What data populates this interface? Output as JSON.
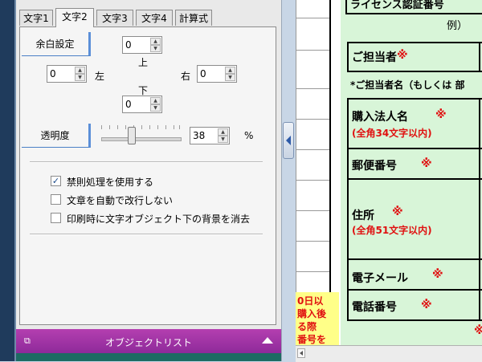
{
  "tabs": [
    {
      "label": "文字1",
      "active": false
    },
    {
      "label": "文字2",
      "active": true
    },
    {
      "label": "文字3",
      "active": false
    },
    {
      "label": "文字4",
      "active": false
    },
    {
      "label": "計算式",
      "active": false
    }
  ],
  "margin": {
    "section_label": "余白設定",
    "top": {
      "label": "上",
      "value": "0"
    },
    "left": {
      "label": "左",
      "value": "0"
    },
    "right": {
      "label": "右",
      "value": "0"
    },
    "bottom": {
      "label": "下",
      "value": "0"
    }
  },
  "opacity": {
    "section_label": "透明度",
    "value": "38",
    "unit": "%",
    "slider_level": 38
  },
  "options": [
    {
      "label": "禁則処理を使用する",
      "checked": true
    },
    {
      "label": "文章を自動で改行しない",
      "checked": false
    },
    {
      "label": "印刷時に文字オブジェクト下の背景を消去",
      "checked": false
    }
  ],
  "object_list": {
    "title": "オブジェクトリスト"
  },
  "document": {
    "license_header": "ライセンス認証番号",
    "example": "例）",
    "person_in_charge": "ご担当者",
    "note": "*ご担当者名（もしくは 部",
    "company_name": "購入法人名",
    "company_limit": "(全角34文字以内)",
    "postal_code": "郵便番号",
    "address": "住所",
    "address_limit": "(全角51文字以内)",
    "email": "電子メール",
    "phone": "電話番号",
    "required_mark": "※",
    "side_note": [
      "0日以",
      "購入後",
      "る際",
      "番号を"
    ]
  },
  "colors": {
    "accent_blue": "#5b8fd8",
    "object_list_purple": "#a436a6",
    "required_red": "#e01010",
    "form_green": "#d8f5d8",
    "note_yellow": "#ffff88"
  }
}
